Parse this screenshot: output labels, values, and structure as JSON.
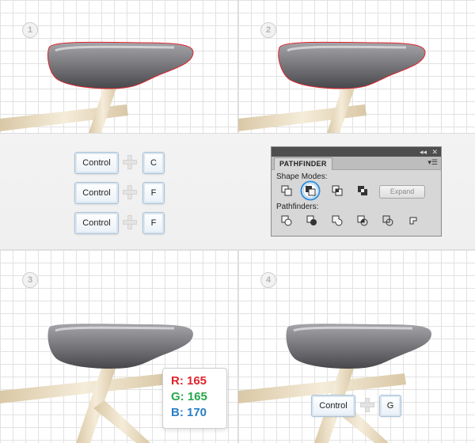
{
  "steps": [
    {
      "number": "1"
    },
    {
      "number": "2"
    },
    {
      "number": "3"
    },
    {
      "number": "4"
    }
  ],
  "shortcuts": [
    {
      "modifier": "Control",
      "key": "C"
    },
    {
      "modifier": "Control",
      "key": "F"
    },
    {
      "modifier": "Control",
      "key": "F"
    }
  ],
  "step4_shortcut": {
    "modifier": "Control",
    "key": "G"
  },
  "pathfinder": {
    "title": "PATHFINDER",
    "collapse_glyph": "◂◂",
    "close_glyph": "✕",
    "menu_glyph": "▾☰",
    "shape_modes_label": "Shape Modes:",
    "pathfinders_label": "Pathfinders:",
    "expand_label": "Expand",
    "selected_mode": "Minus Front"
  },
  "color_tip": {
    "r_label": "R: 165",
    "g_label": "G: 165",
    "b_label": "B: 170",
    "r_color": "#e0242c",
    "g_color": "#27a64a",
    "b_color": "#2a7fc6"
  },
  "colors": {
    "seat_dark": "#545458",
    "seat_light": "#a5a5aa",
    "frame": "#eadcc0",
    "selection": "#e0242c",
    "highlight_ring": "#3a8fd6"
  }
}
